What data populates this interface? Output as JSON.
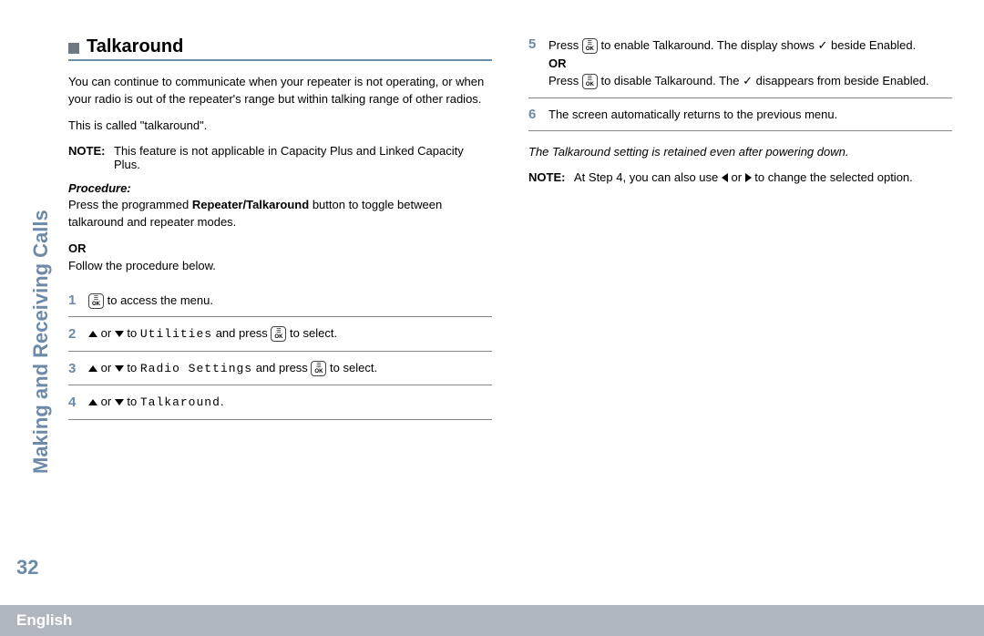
{
  "sidebar": "Making and Receiving Calls",
  "pageNumber": "32",
  "footer": "English",
  "heading": "Talkaround",
  "intro1": "You can continue to communicate when your repeater is not operating, or when your radio is out of the repeater's range but within talking range of other radios.",
  "intro2": "This is called \"talkaround\".",
  "note1Label": "NOTE:",
  "note1Text": "This feature is not applicable in Capacity Plus and Linked Capacity Plus.",
  "procedureLabel": "Procedure:",
  "procText1a": "Press the programmed ",
  "procText1b": "Repeater/Talkaround",
  "procText1c": " button to toggle between talkaround and repeater modes.",
  "or": "OR",
  "procText2": "Follow the procedure below.",
  "step1": " to access the menu.",
  "step2a": " or ",
  "step2b": " to ",
  "step2mono": "Utilities",
  "step2c": " and press ",
  "step2d": " to select.",
  "step3mono": "Radio Settings",
  "step4mono": "Talkaround",
  "step4end": ".",
  "step5a": "Press ",
  "step5b": " to enable Talkaround. The display shows ",
  "step5c": " beside Enabled.",
  "step5d": " to disable Talkaround. The ",
  "step5e": " disappears from beside Enabled.",
  "step6": "The screen automatically returns to the previous menu.",
  "retain": "The Talkaround setting is retained even after powering down.",
  "note2a": "At Step 4, you can also use ",
  "note2b": " or ",
  "note2c": " to change the selected option.",
  "okTop": "☰",
  "okBot": "OK",
  "check": "✓"
}
